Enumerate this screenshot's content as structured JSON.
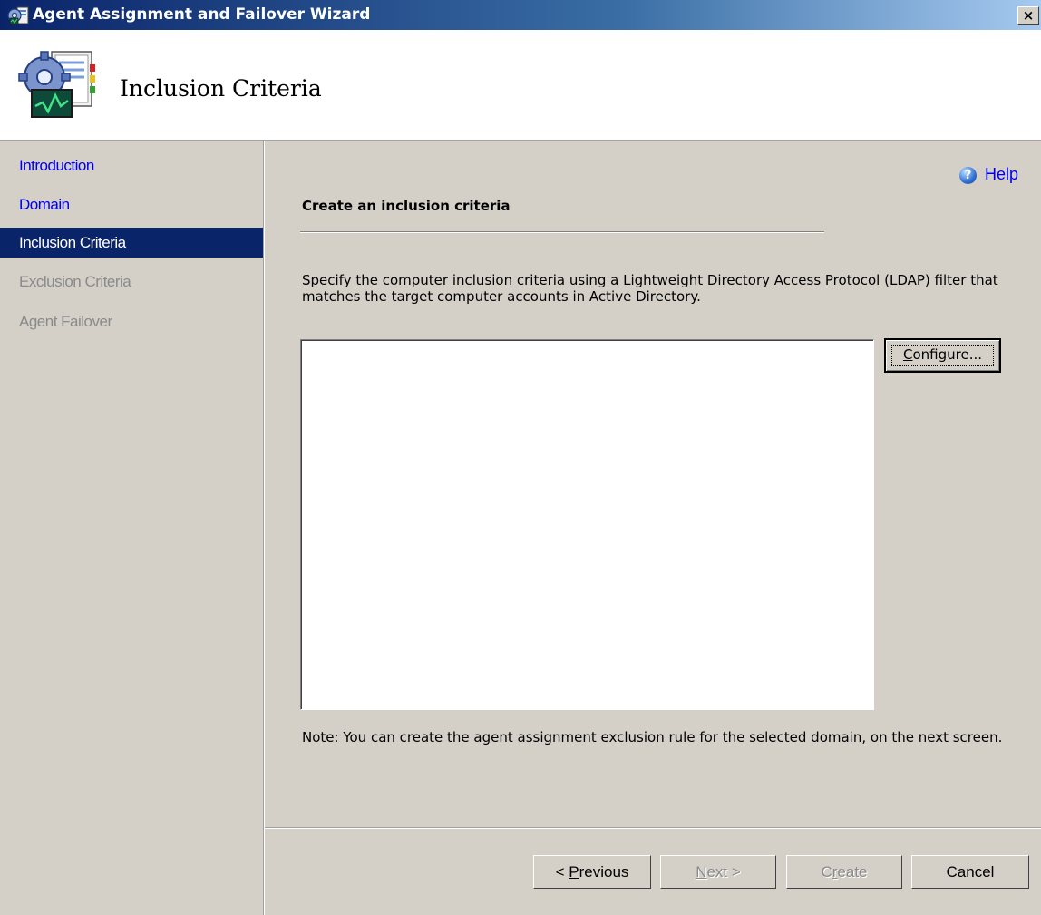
{
  "window": {
    "title": "Agent Assignment and Failover Wizard",
    "close_glyph": "×",
    "icon": "wizard-app-icon"
  },
  "header": {
    "title": "Inclusion Criteria",
    "icon": "wizard-gear-book-icon"
  },
  "sidebar": {
    "items": [
      {
        "label": "Introduction",
        "state": "link"
      },
      {
        "label": "Domain",
        "state": "link"
      },
      {
        "label": "Inclusion Criteria",
        "state": "active"
      },
      {
        "label": "Exclusion Criteria",
        "state": "disabled"
      },
      {
        "label": "Agent Failover",
        "state": "disabled"
      }
    ]
  },
  "help": {
    "label": "Help",
    "icon_glyph": "?"
  },
  "main": {
    "section_title": "Create an inclusion criteria",
    "description": "Specify the computer inclusion criteria using a Lightweight Directory Access Protocol (LDAP) filter that matches the target computer accounts in Active Directory.",
    "criteria_value": "",
    "configure_button": {
      "pre": "",
      "accel": "C",
      "post": "onfigure..."
    },
    "note": "Note: You can create the agent assignment exclusion rule for the selected domain, on the next screen."
  },
  "footer": {
    "previous": {
      "pre": "< ",
      "accel": "P",
      "post": "revious"
    },
    "next": {
      "pre": "",
      "accel": "N",
      "post": "ext >"
    },
    "create": {
      "pre": "C",
      "accel": "r",
      "post": "eate"
    },
    "cancel": "Cancel"
  },
  "colors": {
    "titlebar_start": "#0a246a",
    "titlebar_end": "#a6caf0",
    "selection": "#0a246a",
    "link": "#0000ee",
    "dialog_face": "#d4d0c8"
  }
}
